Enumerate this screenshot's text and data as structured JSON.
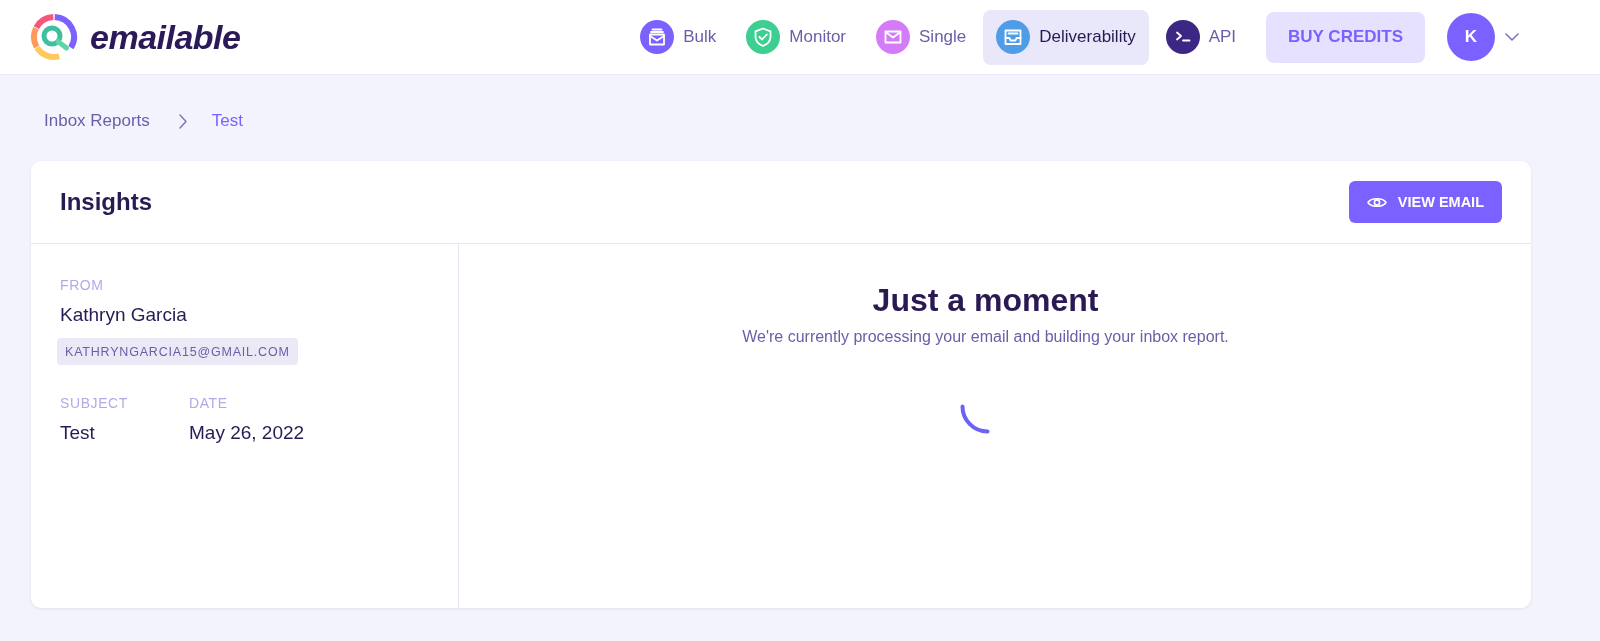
{
  "header": {
    "logo": "emailable",
    "nav": [
      {
        "label": "Bulk",
        "color": "#7b61ff",
        "selected": false
      },
      {
        "label": "Monitor",
        "color": "#3ccf91",
        "selected": false
      },
      {
        "label": "Single",
        "color": "#d47cf7",
        "selected": false
      },
      {
        "label": "Deliverability",
        "color": "#4f9de6",
        "selected": true
      },
      {
        "label": "API",
        "color": "#3d2785",
        "selected": false
      }
    ],
    "buy_credits": "BUY CREDITS",
    "avatar": "K"
  },
  "breadcrumb": [
    {
      "label": "Inbox Reports",
      "selected": false
    },
    {
      "label": "Test",
      "selected": true
    }
  ],
  "card": {
    "title": "Insights",
    "view_button": "VIEW EMAIL",
    "sender": {
      "label": "FROM",
      "name": "Kathryn Garcia",
      "email": "KATHRYNGARCIA15@GMAIL.COM"
    },
    "fields": [
      {
        "label": "SUBJECT",
        "value": "Test"
      },
      {
        "label": "DATE",
        "value": "May 26, 2022"
      }
    ],
    "status": {
      "title": "Just a moment",
      "message": "We're currently processing your email and building your inbox report."
    }
  }
}
